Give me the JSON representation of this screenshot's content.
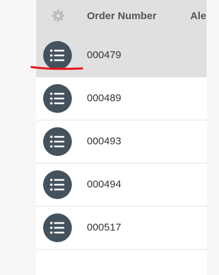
{
  "table": {
    "headers": {
      "settings_icon": "gear-icon",
      "order_number": "Order Number",
      "next_column": "Ale"
    },
    "rows": [
      {
        "order_number": "000479",
        "selected": true
      },
      {
        "order_number": "000489"
      },
      {
        "order_number": "000493"
      },
      {
        "order_number": "000494"
      },
      {
        "order_number": "000517"
      }
    ],
    "row_button_icon": "list-icon"
  },
  "colors": {
    "header_bg": "#e0e0e0",
    "button_bg": "#44525e",
    "annotation": "#e8141c"
  }
}
